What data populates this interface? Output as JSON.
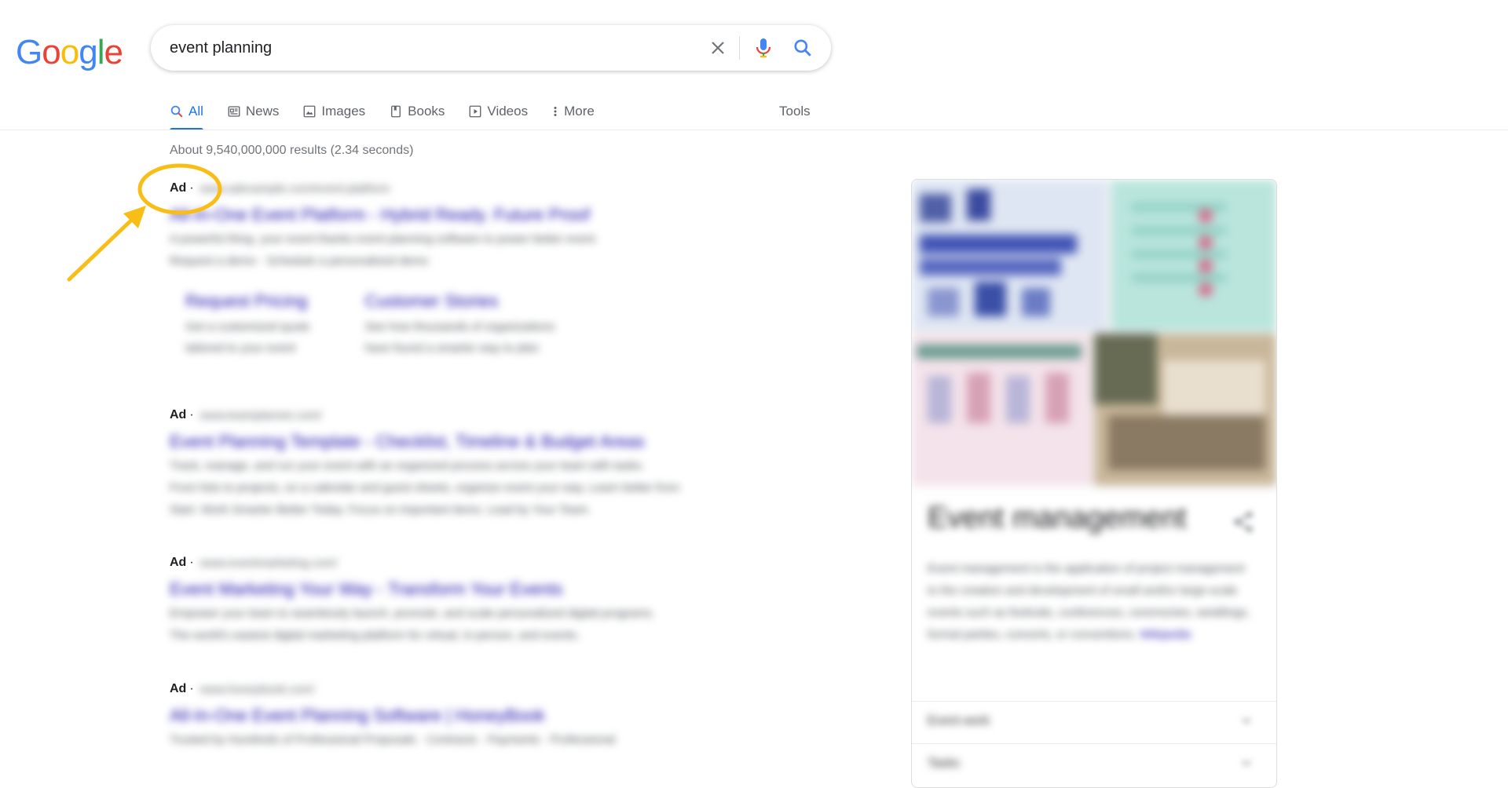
{
  "logo": {
    "letters": [
      "G",
      "o",
      "o",
      "g",
      "l",
      "e"
    ],
    "colors": [
      "#4285F4",
      "#EA4335",
      "#FBBC05",
      "#4285F4",
      "#34A853",
      "#EA4335"
    ]
  },
  "search": {
    "query": "event planning",
    "placeholder": ""
  },
  "tabs": [
    {
      "label": "All",
      "icon": "search-icon",
      "active": true
    },
    {
      "label": "News",
      "icon": "news-icon",
      "active": false
    },
    {
      "label": "Images",
      "icon": "image-icon",
      "active": false
    },
    {
      "label": "Books",
      "icon": "book-icon",
      "active": false
    },
    {
      "label": "Videos",
      "icon": "video-icon",
      "active": false
    },
    {
      "label": "More",
      "icon": "more-vert-icon",
      "active": false
    }
  ],
  "tools_label": "Tools",
  "result_stats": "About 9,540,000,000 results (2.34 seconds)",
  "ads": [
    {
      "label": "Ad",
      "url": "www.adexample.com/event-platform",
      "title": "All-In-One Event Platform - Hybrid Ready. Future Proof",
      "desc": [
        "A powerful thing. your event thanks event planning software to power better event.",
        "Request a demo · Schedule a personalized demo"
      ],
      "sitelinks": [
        {
          "title": "Request Pricing",
          "desc": [
            "Get a customized quote",
            "tailored to your event"
          ]
        },
        {
          "title": "Customer Stories",
          "desc": [
            "See how thousands of organizations",
            "have found a smarter way to plan"
          ]
        }
      ]
    },
    {
      "label": "Ad",
      "url": "www.teamplanner.com/",
      "title": "Event Planning Template - Checklist, Timeline & Budget Areas",
      "desc": [
        "Track, manage, and run your event with an organized process across your team with tasks.",
        "From lists to projects, on a calendar and guest sheets, organize event your way. Learn better from",
        "Start. Work Smarter Better Today. Focus on important items. Lead by Your Team."
      ]
    },
    {
      "label": "Ad",
      "url": "www.eventmarketing.com/",
      "title": "Event Marketing Your Way - Transform Your Events",
      "desc": [
        "Empower your team to seamlessly launch, promote, and scale personalized digital programs.",
        "The world's easiest digital marketing platform for virtual, in-person, and events."
      ]
    },
    {
      "label": "Ad",
      "url": "www.honeybook.com/",
      "title": "All-In-One Event Planning Software | HoneyBook",
      "desc": [
        "Trusted by Hundreds of Professional Proposals · Contracts · Payments · Professional"
      ]
    }
  ],
  "annotation": {
    "color": "#F9BE16"
  },
  "knowledge_panel": {
    "title": "Event management",
    "desc": "Event management is the application of project management to the creation and development of small and/or large-scale events such as festivals, conferences, ceremonies, weddings, formal parties, concerts, or conventions.",
    "more_label": "Wikipedia",
    "rows": [
      {
        "label": "Event work"
      },
      {
        "label": "Tasks"
      }
    ]
  }
}
